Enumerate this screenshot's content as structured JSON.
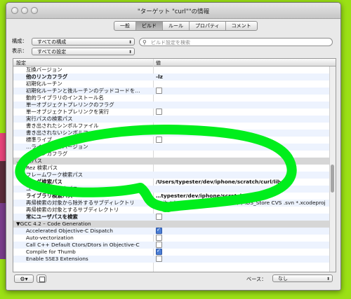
{
  "window": {
    "title": "\"ターゲット \"curl\"\"の情報"
  },
  "tabs": [
    {
      "label": "一般",
      "selected": false
    },
    {
      "label": "ビルド",
      "selected": true
    },
    {
      "label": "ルール",
      "selected": false
    },
    {
      "label": "プロパティ",
      "selected": false
    },
    {
      "label": "コメント",
      "selected": false
    }
  ],
  "filters": {
    "config_label": "構成：",
    "config_value": "すべての構成",
    "show_label": "表示：",
    "show_value": "すべての設定",
    "search_placeholder": "ビルド設定を検索"
  },
  "table": {
    "col_setting": "設定",
    "col_value": "値",
    "rows": [
      {
        "name": "互換バージョン",
        "value": "",
        "bold": false,
        "type": "text"
      },
      {
        "name": "他のリンカフラグ",
        "value": "-lz",
        "bold": true,
        "type": "text"
      },
      {
        "name": "初期化ルーチン",
        "value": "",
        "bold": false,
        "type": "text"
      },
      {
        "name": "初期化ルーチンと後ルーチンのデッドコードを…",
        "value": "",
        "bold": false,
        "type": "checkbox",
        "checked": false
      },
      {
        "name": "動的ライブラリのインストール名",
        "value": "",
        "bold": false,
        "type": "text"
      },
      {
        "name": "単一オブジェクトプレリンクのフラグ",
        "value": "",
        "bold": false,
        "type": "text"
      },
      {
        "name": "単一オブジェクトプレリンクを実行",
        "value": "",
        "bold": false,
        "type": "checkbox",
        "checked": false
      },
      {
        "name": "実行パスの検索パス",
        "value": "",
        "bold": false,
        "type": "text"
      },
      {
        "name": "書き出されたシンボルファイル",
        "value": "",
        "bold": false,
        "type": "text"
      },
      {
        "name": "書き出されないシンボルファイル",
        "value": "",
        "bold": false,
        "type": "text"
      },
      {
        "name": "標準ライブ…",
        "value": "",
        "bold": false,
        "type": "checkbox",
        "checked": false
      },
      {
        "name": "…ライブラリのバージョン",
        "value": "",
        "bold": false,
        "type": "text"
      },
      {
        "name": "…プリンカフラグ",
        "value": "",
        "bold": false,
        "type": "text"
      },
      {
        "name": "…検索パス",
        "value": "",
        "bold": false,
        "type": "section"
      },
      {
        "name": "Rez 検索パス",
        "value": "",
        "bold": false,
        "type": "text"
      },
      {
        "name": "フレームワーク検索パス",
        "value": "",
        "bold": false,
        "type": "text"
      },
      {
        "name": "ヘッダ検索パス",
        "value": "/Users/typester/dev/iphone/scratch/curl/libcurl",
        "bold": true,
        "type": "text"
      },
      {
        "name": "ユーザヘッダ検索パス",
        "value": "",
        "bold": false,
        "type": "text"
      },
      {
        "name": "ライブラリ検索パス",
        "value": "…typester/dev/iphone/scratch/curl/…",
        "bold": true,
        "type": "text"
      },
      {
        "name": "再帰検索の対象から除外するサブディレクトリ",
        "value": "*.nib *.lproj *.framework *.gch (*) .DS_Store CVS .svn *.xcodeproj *.xcode *.pbproj …",
        "bold": false,
        "type": "text"
      },
      {
        "name": "再帰検索の対象とするサブディレクトリ",
        "value": "",
        "bold": false,
        "type": "text"
      },
      {
        "name": "常にユーザパスを検索",
        "value": "",
        "bold": true,
        "type": "checkbox",
        "checked": false
      },
      {
        "name": "▼GCC 4.2 – Code Generation",
        "value": "",
        "bold": false,
        "type": "section"
      },
      {
        "name": "Accelerated Objective-C Dispatch",
        "value": "",
        "bold": false,
        "type": "checkbox",
        "checked": true
      },
      {
        "name": "Auto-vectorization",
        "value": "",
        "bold": false,
        "type": "checkbox",
        "checked": false
      },
      {
        "name": "Call C++ Default Ctors/Dtors in Objective-C",
        "value": "",
        "bold": false,
        "type": "checkbox",
        "checked": false
      },
      {
        "name": "Compile for Thumb",
        "value": "",
        "bold": false,
        "type": "checkbox",
        "checked": true
      },
      {
        "name": "Enable SSE3 Extensions",
        "value": "",
        "bold": false,
        "type": "checkbox",
        "checked": false
      }
    ]
  },
  "bottom": {
    "base_label": "ベース：",
    "base_value": "なし",
    "gear_icon": "gear-icon",
    "doc_icon": "document-icon"
  },
  "colors": {
    "annotation": "#00ee1c",
    "background": "#9be015"
  }
}
